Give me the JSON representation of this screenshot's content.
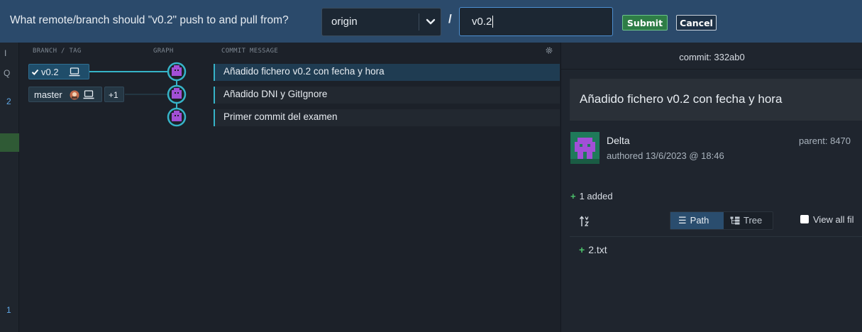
{
  "prompt": {
    "question": "What remote/branch should \"v0.2\" push to and pull from?",
    "remote_value": "origin",
    "branch_value": "v0.2",
    "submit_label": "Submit",
    "cancel_label": "Cancel",
    "separator": "/"
  },
  "left_strip": {
    "marks": [
      "I",
      "Q",
      "2",
      "1"
    ]
  },
  "graph": {
    "headers": {
      "branch_tag": "BRANCH / TAG",
      "graph": "GRAPH",
      "commit_message": "COMMIT MESSAGE"
    },
    "rows": [
      {
        "tag": "v0.2",
        "message": "Añadido fichero v0.2 con fecha y hora",
        "selected": true
      },
      {
        "tag": "master",
        "extra": "+1",
        "message": "Añadido DNI y GitIgnore",
        "selected": false
      },
      {
        "message": "Primer commit del examen",
        "selected": false
      }
    ]
  },
  "detail": {
    "commit_label": "commit: 332ab0",
    "title": "Añadido fichero v0.2 con fecha y hora",
    "author": "Delta",
    "authored": "authored 13/6/2023 @ 18:46",
    "parent": "parent: 8470",
    "added_summary": "1 added",
    "view_path_label": "Path",
    "view_tree_label": "Tree",
    "view_all_label": "View all fil",
    "files": [
      {
        "status": "+",
        "name": "2.txt"
      }
    ]
  },
  "colors": {
    "accent": "#36b4c8",
    "prompt_bar": "#2b4a6b",
    "submit": "#2e7d46",
    "added": "#4cc26b",
    "avatar": "#a24fd6"
  }
}
